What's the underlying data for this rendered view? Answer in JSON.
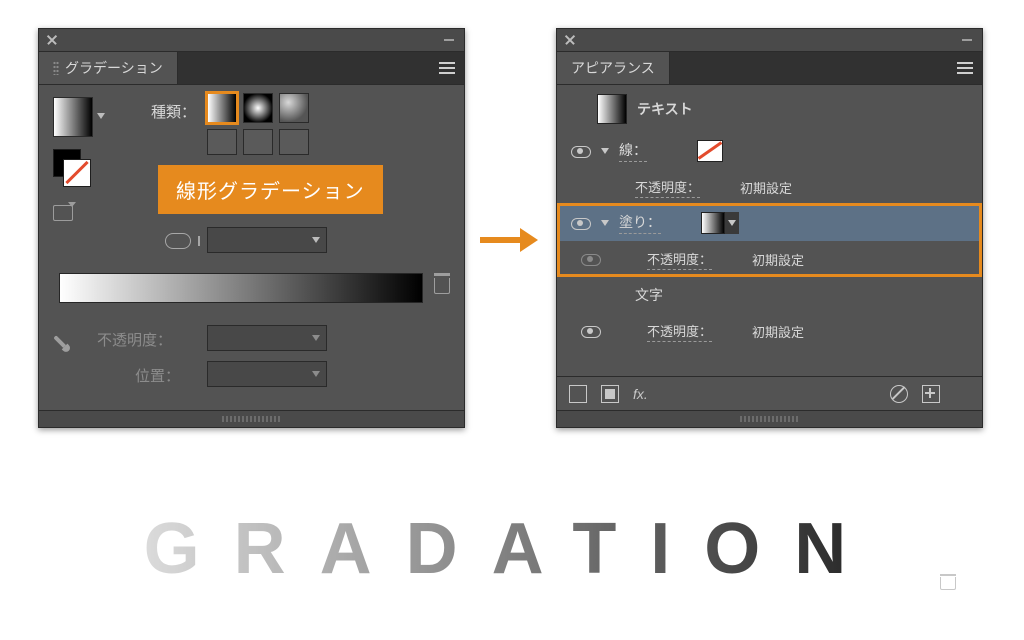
{
  "left_panel": {
    "tab_title": "グラデーション",
    "type_label": "種類：",
    "callout_label": "線形グラデーション",
    "opacity_label": "不透明度：",
    "position_label": "位置："
  },
  "right_panel": {
    "tab_title": "アピアランス",
    "header_label": "テキスト",
    "stroke_label": "線：",
    "opacity_label": "不透明度：",
    "opacity_value": "初期設定",
    "fill_label": "塗り：",
    "char_label": "文字",
    "fx_label": "fx."
  },
  "bottom_word": "GRADATION"
}
